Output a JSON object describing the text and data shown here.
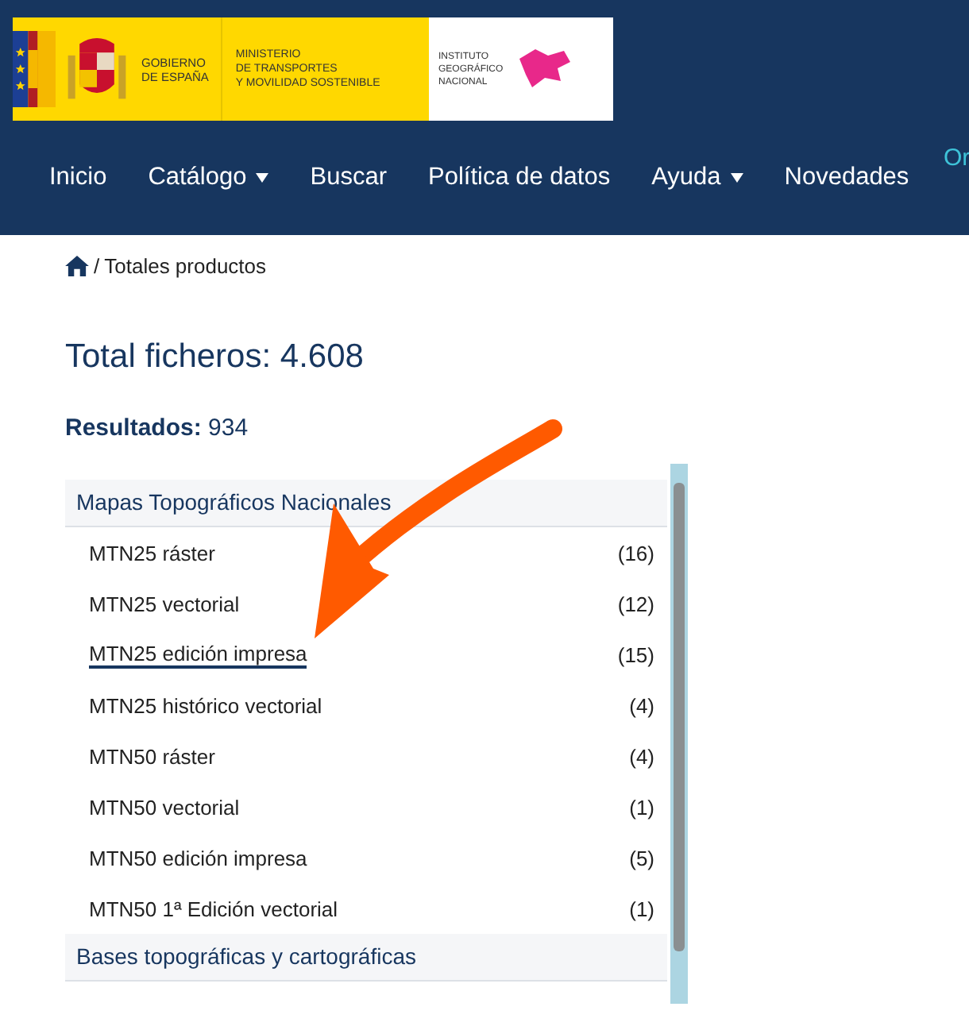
{
  "logo": {
    "government": [
      "GOBIERNO",
      "DE ESPAÑA"
    ],
    "ministry": [
      "MINISTERIO",
      "DE TRANSPORTES",
      "Y MOVILIDAD SOSTENIBLE"
    ],
    "institute": [
      "INSTITUTO",
      "GEOGRÁFICO",
      "NACIONAL"
    ]
  },
  "top_link": "Or",
  "nav": [
    {
      "label": "Inicio",
      "dropdown": false
    },
    {
      "label": "Catálogo",
      "dropdown": true
    },
    {
      "label": "Buscar",
      "dropdown": false
    },
    {
      "label": "Política de datos",
      "dropdown": false
    },
    {
      "label": "Ayuda",
      "dropdown": true
    },
    {
      "label": "Novedades",
      "dropdown": false
    }
  ],
  "breadcrumb": "Totales productos",
  "breadcrumb_separator": "/",
  "title": "Total ficheros: 4.608",
  "results": {
    "label": "Resultados:",
    "value": "934"
  },
  "groups": [
    {
      "name": "Mapas Topográficos Nacionales",
      "items": [
        {
          "name": "MTN25 ráster",
          "count": "(16)",
          "selected": false
        },
        {
          "name": "MTN25 vectorial",
          "count": "(12)",
          "selected": false
        },
        {
          "name": "MTN25 edición impresa",
          "count": "(15)",
          "selected": true
        },
        {
          "name": "MTN25 histórico vectorial",
          "count": "(4)",
          "selected": false
        },
        {
          "name": "MTN50 ráster",
          "count": "(4)",
          "selected": false
        },
        {
          "name": "MTN50 vectorial",
          "count": "(1)",
          "selected": false
        },
        {
          "name": "MTN50 edición impresa",
          "count": "(5)",
          "selected": false
        },
        {
          "name": "MTN50 1ª Edición vectorial",
          "count": "(1)",
          "selected": false
        }
      ]
    },
    {
      "name": "Bases topográficas y cartográficas"
    }
  ]
}
